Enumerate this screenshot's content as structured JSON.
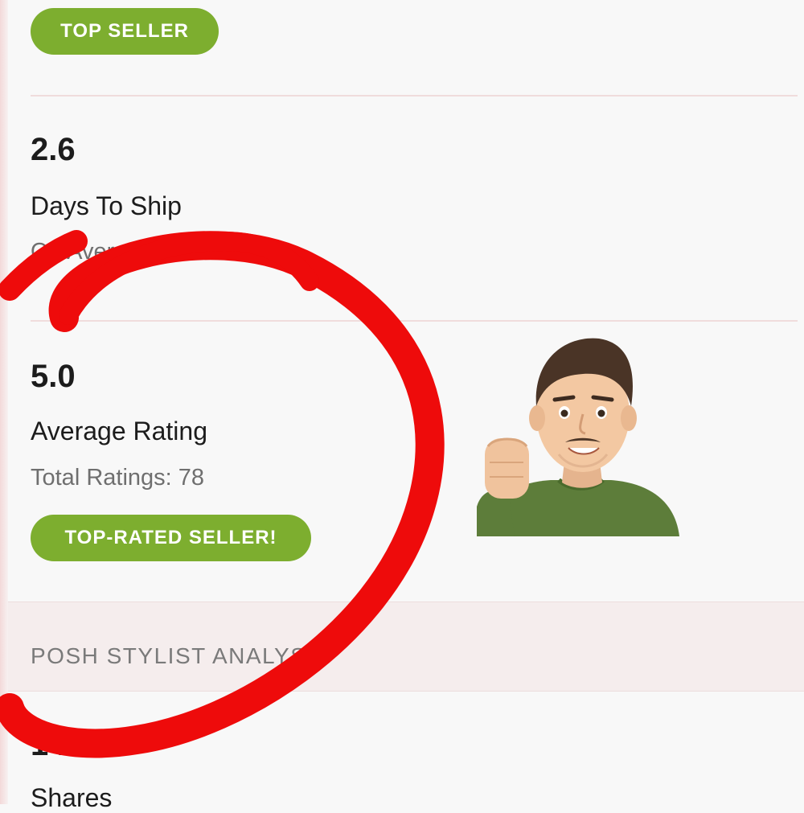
{
  "badges": {
    "top_seller": "TOP SELLER",
    "top_rated": "TOP-RATED SELLER!"
  },
  "stats": {
    "shipping": {
      "value": "2.6",
      "label": "Days To Ship",
      "sublabel": "On Average"
    },
    "rating": {
      "value": "5.0",
      "label": "Average Rating",
      "sublabel": "Total Ratings: 78"
    },
    "shares": {
      "value": "1482",
      "label": "Shares"
    }
  },
  "section": {
    "title": "POSH STYLIST ANALYSIS"
  },
  "colors": {
    "badge_green": "#7dae2f",
    "annotation_red": "#ee0b0b",
    "shirt_green": "#5d7d3a"
  },
  "icons": {
    "annotation": "red-hand-drawn-circle",
    "avatar": "memoji-raised-fist"
  }
}
